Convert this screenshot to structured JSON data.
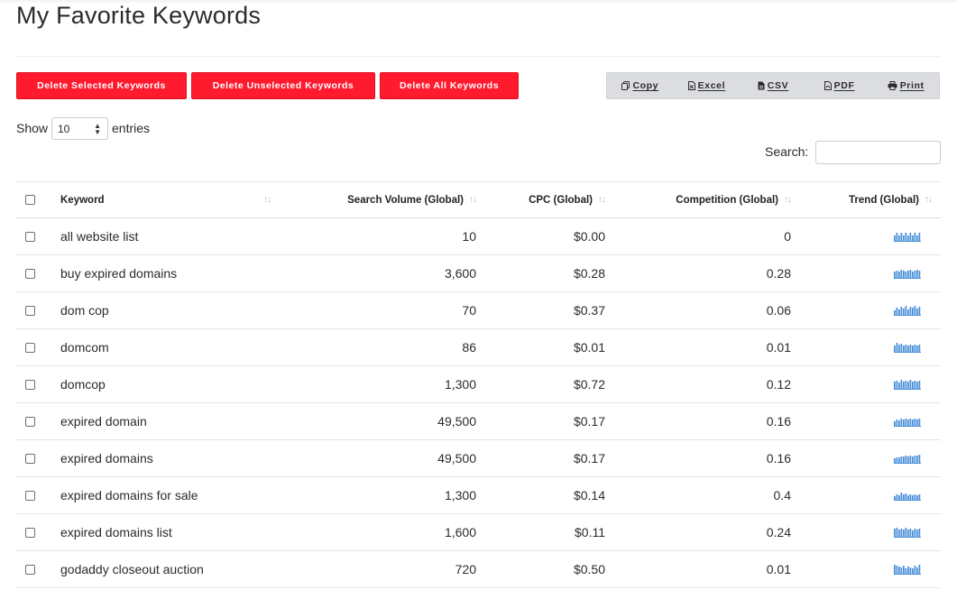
{
  "page": {
    "title": "My Favorite Keywords"
  },
  "actions": {
    "delete_selected": "Delete Selected Keywords",
    "delete_unselected": "Delete Unselected Keywords",
    "delete_all": "Delete All Keywords"
  },
  "export": {
    "copy": "Copy",
    "excel": "Excel",
    "csv": "CSV",
    "pdf": "PDF",
    "print": "Print"
  },
  "length": {
    "show": "Show",
    "selected": "10",
    "entries": "entries"
  },
  "search": {
    "label": "Search:",
    "value": ""
  },
  "table": {
    "headers": {
      "keyword": "Keyword",
      "volume": "Search Volume (Global)",
      "cpc": "CPC (Global)",
      "competition": "Competition (Global)",
      "trend": "Trend (Global)"
    },
    "rows": [
      {
        "keyword": "all website list",
        "volume": "10",
        "cpc": "$0.00",
        "competition": "0",
        "trend": [
          0.6,
          0.9,
          0.6,
          0.9,
          0.6,
          0.9,
          0.6,
          0.9,
          0.6,
          0.9,
          0.6,
          0.9
        ]
      },
      {
        "keyword": "buy expired domains",
        "volume": "3,600",
        "cpc": "$0.28",
        "competition": "0.28",
        "trend": [
          0.7,
          0.8,
          0.7,
          0.9,
          0.8,
          0.7,
          0.8,
          0.9,
          0.7,
          0.8,
          0.9,
          0.8
        ]
      },
      {
        "keyword": "dom cop",
        "volume": "70",
        "cpc": "$0.37",
        "competition": "0.06",
        "trend": [
          0.5,
          0.8,
          0.6,
          0.9,
          0.7,
          1.0,
          0.6,
          0.9,
          0.8,
          1.0,
          0.7,
          0.9
        ]
      },
      {
        "keyword": "domcom",
        "volume": "86",
        "cpc": "$0.01",
        "competition": "0.01",
        "trend": [
          0.7,
          1.0,
          0.8,
          0.9,
          0.7,
          0.8,
          0.7,
          0.8,
          0.7,
          0.8,
          0.7,
          0.8
        ]
      },
      {
        "keyword": "domcop",
        "volume": "1,300",
        "cpc": "$0.72",
        "competition": "0.12",
        "trend": [
          0.8,
          0.9,
          0.7,
          1.0,
          0.8,
          0.9,
          0.8,
          1.0,
          0.8,
          0.9,
          0.8,
          0.9
        ]
      },
      {
        "keyword": "expired domain",
        "volume": "49,500",
        "cpc": "$0.17",
        "competition": "0.16",
        "trend": [
          0.5,
          0.7,
          0.6,
          0.8,
          0.7,
          0.8,
          0.7,
          0.8,
          0.7,
          0.8,
          0.7,
          0.8
        ]
      },
      {
        "keyword": "expired domains",
        "volume": "49,500",
        "cpc": "$0.17",
        "competition": "0.16",
        "trend": [
          0.5,
          0.6,
          0.6,
          0.7,
          0.7,
          0.8,
          0.7,
          0.8,
          0.7,
          0.8,
          0.8,
          0.9
        ]
      },
      {
        "keyword": "expired domains for sale",
        "volume": "1,300",
        "cpc": "$0.14",
        "competition": "0.4",
        "trend": [
          0.4,
          0.6,
          0.5,
          0.8,
          0.6,
          0.7,
          0.5,
          0.6,
          0.5,
          0.6,
          0.5,
          0.6
        ]
      },
      {
        "keyword": "expired domains list",
        "volume": "1,600",
        "cpc": "$0.11",
        "competition": "0.24",
        "trend": [
          0.9,
          1.0,
          0.8,
          0.9,
          0.8,
          1.0,
          0.8,
          0.9,
          0.7,
          0.9,
          0.8,
          0.9
        ]
      },
      {
        "keyword": "godaddy closeout auction",
        "volume": "720",
        "cpc": "$0.50",
        "competition": "0.01",
        "trend": [
          1.0,
          0.9,
          0.8,
          0.7,
          0.9,
          0.6,
          0.8,
          0.7,
          0.6,
          0.9,
          0.7,
          1.0
        ]
      }
    ]
  },
  "colors": {
    "danger": "#ff1a2e",
    "trend": "#4a90d9",
    "export_bg": "#dcdde0"
  },
  "icons": {
    "copy": "copy-icon",
    "excel": "file-excel-icon",
    "csv": "file-csv-icon",
    "pdf": "file-pdf-icon",
    "print": "print-icon",
    "sort": "sort-arrows-icon"
  }
}
